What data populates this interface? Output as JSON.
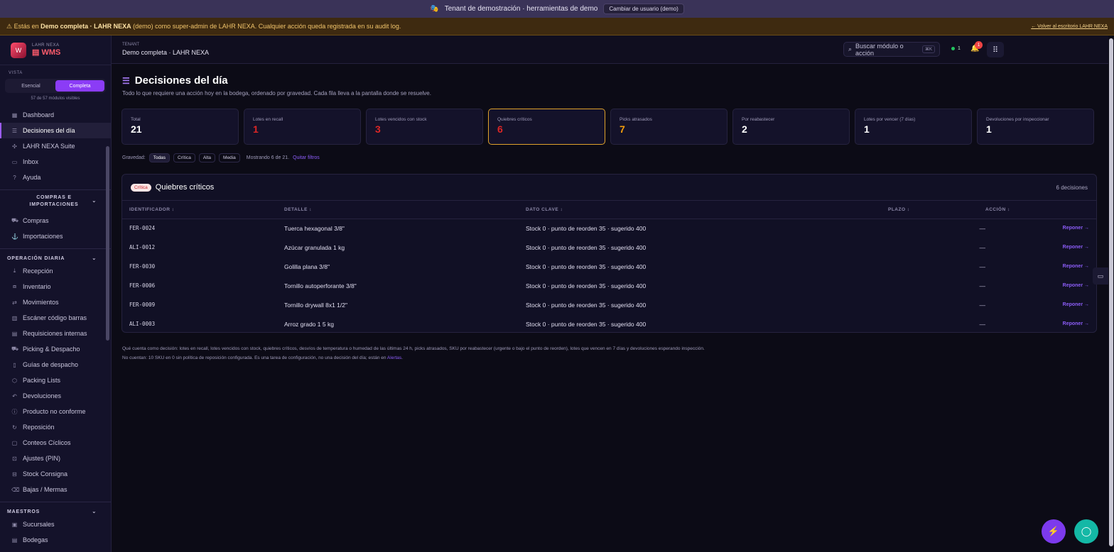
{
  "topbar": {
    "text": "Tenant de demostración · herramientas de demo",
    "switch_label": "Cambiar de usuario (demo)"
  },
  "warning": {
    "prefix": "Estás en",
    "tenant": "Demo completa · LAHR NEXA",
    "mid": "(demo) como super-admin de LAHR NEXA. Cualquier acción queda registrada en su audit log.",
    "back": "← Volver al escritorio LAHR NEXA"
  },
  "brand": {
    "company": "LAHR NEXA",
    "app": "WMS"
  },
  "sidebar": {
    "vista_label": "VISTA",
    "toggle": [
      "Esencial",
      "Completa"
    ],
    "module_count": "57 de 57 módulos visibles",
    "top_items": [
      {
        "label": "Dashboard",
        "icon": "grid-icon"
      },
      {
        "label": "Decisiones del día",
        "icon": "checklist-icon"
      },
      {
        "label": "LAHR NEXA Suite",
        "icon": "network-icon"
      },
      {
        "label": "Inbox",
        "icon": "inbox-icon"
      },
      {
        "label": "Ayuda",
        "icon": "help-icon"
      }
    ],
    "section_compras": "COMPRAS E IMPORTACIONES",
    "compras_items": [
      {
        "label": "Compras"
      },
      {
        "label": "Importaciones"
      }
    ],
    "section_operacion": "OPERACIÓN DIARIA",
    "operacion_items": [
      {
        "label": "Recepción"
      },
      {
        "label": "Inventario"
      },
      {
        "label": "Movimientos"
      },
      {
        "label": "Escáner código barras"
      },
      {
        "label": "Requisiciones internas"
      },
      {
        "label": "Picking & Despacho"
      },
      {
        "label": "Guías de despacho"
      },
      {
        "label": "Packing Lists"
      },
      {
        "label": "Devoluciones"
      },
      {
        "label": "Producto no conforme"
      },
      {
        "label": "Reposición"
      },
      {
        "label": "Conteos Cíclicos"
      },
      {
        "label": "Ajustes (PIN)"
      },
      {
        "label": "Stock Consigna"
      },
      {
        "label": "Bajas / Mermas"
      }
    ],
    "section_maestros": "MAESTROS",
    "maestros_items": [
      {
        "label": "Sucursales"
      },
      {
        "label": "Bodegas"
      }
    ]
  },
  "header": {
    "tenant_label": "TENANT",
    "tenant_name": "Demo completa · LAHR NEXA",
    "search_placeholder": "Buscar módulo o acción",
    "search_kbd": "⌘K",
    "online_count": "1",
    "notif_count": "1"
  },
  "page": {
    "title": "Decisiones del día",
    "subtitle": "Todo lo que requiere una acción hoy en la bodega, ordenado por gravedad. Cada fila lleva a la pantalla donde se resuelve.",
    "cards": [
      {
        "label": "Total",
        "value": "21",
        "color": "#ffffff"
      },
      {
        "label": "Lotes en recall",
        "value": "1",
        "color": "#dc2626"
      },
      {
        "label": "Lotes vencidos con stock",
        "value": "3",
        "color": "#dc2626"
      },
      {
        "label": "Quiebres críticos",
        "value": "6",
        "color": "#dc2626"
      },
      {
        "label": "Picks atrasados",
        "value": "7",
        "color": "#f59e0b"
      },
      {
        "label": "Por reabastecer",
        "value": "2",
        "color": "#ffffff"
      },
      {
        "label": "Lotes por vencer (7 días)",
        "value": "1",
        "color": "#ffffff"
      },
      {
        "label": "Devoluciones por inspeccionar",
        "value": "1",
        "color": "#ffffff"
      }
    ],
    "filters": {
      "label": "Gravedad:",
      "chips": [
        "Todas",
        "Crítica",
        "Alta",
        "Media"
      ],
      "showing": "Mostrando 6 de 21.",
      "clear": "Quitar filtros"
    },
    "table": {
      "badge": "Crítica",
      "title": "Quiebres críticos",
      "count": "6 decisiones",
      "columns": [
        "IDENTIFICADOR ↕",
        "DETALLE ↕",
        "DATO CLAVE ↕",
        "PLAZO ↕",
        "ACCIÓN ↕"
      ],
      "rows": [
        {
          "id": "FER-0024",
          "detail": "Tuerca hexagonal 3/8\"",
          "key": "Stock 0 · punto de reorden 35 · sugerido 400",
          "plazo": "—",
          "action": "Reponer →"
        },
        {
          "id": "ALI-0012",
          "detail": "Azúcar granulada 1 kg",
          "key": "Stock 0 · punto de reorden 35 · sugerido 400",
          "plazo": "—",
          "action": "Reponer →"
        },
        {
          "id": "FER-0030",
          "detail": "Golilla plana 3/8\"",
          "key": "Stock 0 · punto de reorden 35 · sugerido 400",
          "plazo": "—",
          "action": "Reponer →"
        },
        {
          "id": "FER-0006",
          "detail": "Tornillo autoperforante 3/8\"",
          "key": "Stock 0 · punto de reorden 35 · sugerido 400",
          "plazo": "—",
          "action": "Reponer →"
        },
        {
          "id": "FER-0009",
          "detail": "Tornillo drywall 8x1 1/2\"",
          "key": "Stock 0 · punto de reorden 35 · sugerido 400",
          "plazo": "—",
          "action": "Reponer →"
        },
        {
          "id": "ALI-0003",
          "detail": "Arroz grado 1 5 kg",
          "key": "Stock 0 · punto de reorden 35 · sugerido 400",
          "plazo": "—",
          "action": "Reponer →"
        }
      ]
    },
    "footnote1": "Qué cuenta como decisión: lotes en recall, lotes vencidos con stock, quiebres críticos, desvíos de temperatura o humedad de las últimas 24 h, picks atrasados, SKU por reabastecer (urgente o bajo el punto de reorden), lotes que vencen en 7 días y devoluciones esperando inspección.",
    "footnote2": "No cuentan: 10 SKU en 0 sin política de reposición configurada. Es una tarea de configuración, no una decisión del día; están en",
    "footnote_link": "Alertas",
    "footnote_end": "."
  }
}
